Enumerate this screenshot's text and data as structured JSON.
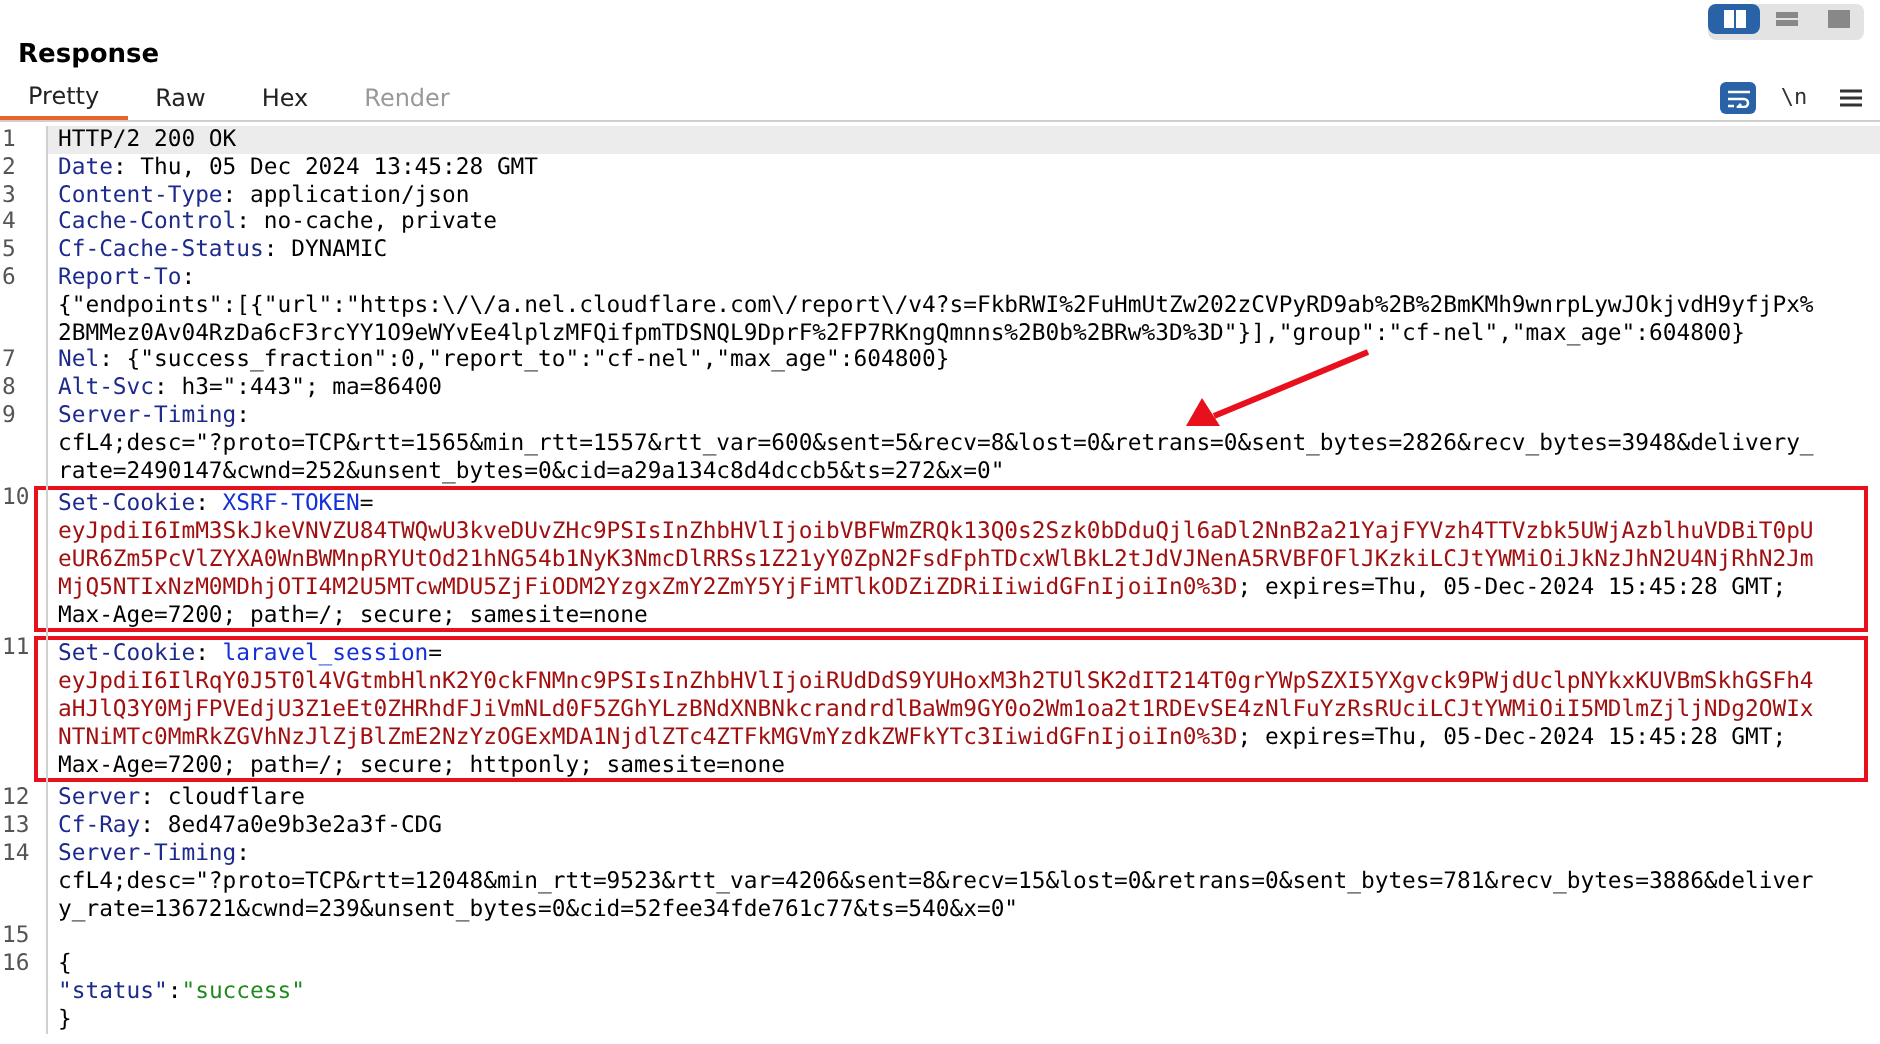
{
  "panel": {
    "title": "Response"
  },
  "view_modes": [
    {
      "kind": "columns",
      "selected": true
    },
    {
      "kind": "rows",
      "selected": false
    },
    {
      "kind": "single",
      "selected": false
    }
  ],
  "tabs": [
    {
      "label": "Pretty",
      "selected": true,
      "disabled": false
    },
    {
      "label": "Raw",
      "selected": false,
      "disabled": false
    },
    {
      "label": "Hex",
      "selected": false,
      "disabled": false
    },
    {
      "label": "Render",
      "selected": false,
      "disabled": true
    }
  ],
  "toolbar": [
    {
      "kind": "wrap",
      "selected": true
    },
    {
      "kind": "newline",
      "label": "\\n",
      "selected": false
    },
    {
      "kind": "menu",
      "selected": false
    }
  ],
  "lines": [
    {
      "number": "1",
      "current": true,
      "boxed": false,
      "wrapped": [
        {
          "spans": [
            {
              "kind": "plain",
              "text": "HTTP/2 200 OK"
            }
          ]
        }
      ]
    },
    {
      "number": "2",
      "current": false,
      "boxed": false,
      "wrapped": [
        {
          "spans": [
            {
              "kind": "name",
              "text": "Date"
            },
            {
              "kind": "plain",
              "text": ": Thu, 05 Dec 2024 13:45:28 GMT"
            }
          ]
        }
      ]
    },
    {
      "number": "3",
      "current": false,
      "boxed": false,
      "wrapped": [
        {
          "spans": [
            {
              "kind": "name",
              "text": "Content-Type"
            },
            {
              "kind": "plain",
              "text": ": application/json"
            }
          ]
        }
      ]
    },
    {
      "number": "4",
      "current": false,
      "boxed": false,
      "wrapped": [
        {
          "spans": [
            {
              "kind": "name",
              "text": "Cache-Control"
            },
            {
              "kind": "plain",
              "text": ": no-cache, private"
            }
          ]
        }
      ]
    },
    {
      "number": "5",
      "current": false,
      "boxed": false,
      "wrapped": [
        {
          "spans": [
            {
              "kind": "name",
              "text": "Cf-Cache-Status"
            },
            {
              "kind": "plain",
              "text": ": DYNAMIC"
            }
          ]
        }
      ]
    },
    {
      "number": "6",
      "current": false,
      "boxed": false,
      "wrapped": [
        {
          "spans": [
            {
              "kind": "name",
              "text": "Report-To"
            },
            {
              "kind": "plain",
              "text": ":"
            }
          ]
        },
        {
          "spans": [
            {
              "kind": "plain",
              "text": "{\"endpoints\":[{\"url\":\"https:\\/\\/a.nel.cloudflare.com\\/report\\/v4?s=FkbRWI%2FuHmUtZw202zCVPyRD9ab%2B%2BmKMh9wnrpLywJOkjvdH9yfjPx%"
            }
          ]
        },
        {
          "spans": [
            {
              "kind": "plain",
              "text": "2BMMez0Av04RzDa6cF3rcYY1O9eWYvEe4lplzMFQifpmTDSNQL9DprF%2FP7RKngQmnns%2B0b%2BRw%3D%3D\"}],\"group\":\"cf-nel\",\"max_age\":604800}"
            }
          ]
        }
      ]
    },
    {
      "number": "7",
      "current": false,
      "boxed": false,
      "wrapped": [
        {
          "spans": [
            {
              "kind": "name",
              "text": "Nel"
            },
            {
              "kind": "plain",
              "text": ": {\"success_fraction\":0,\"report_to\":\"cf-nel\",\"max_age\":604800}"
            }
          ]
        }
      ]
    },
    {
      "number": "8",
      "current": false,
      "boxed": false,
      "wrapped": [
        {
          "spans": [
            {
              "kind": "name",
              "text": "Alt-Svc"
            },
            {
              "kind": "plain",
              "text": ": h3=\":443\"; ma=86400"
            }
          ]
        }
      ]
    },
    {
      "number": "9",
      "current": false,
      "boxed": false,
      "wrapped": [
        {
          "spans": [
            {
              "kind": "name",
              "text": "Server-Timing"
            },
            {
              "kind": "plain",
              "text": ":"
            }
          ]
        },
        {
          "spans": [
            {
              "kind": "plain",
              "text": "cfL4;desc=\"?proto=TCP&rtt=1565&min_rtt=1557&rtt_var=600&sent=5&recv=8&lost=0&retrans=0&sent_bytes=2826&recv_bytes=3948&delivery_"
            }
          ]
        },
        {
          "spans": [
            {
              "kind": "plain",
              "text": "rate=2490147&cwnd=252&unsent_bytes=0&cid=a29a134c8d4dccb5&ts=272&x=0\""
            }
          ]
        }
      ]
    },
    {
      "number": "10",
      "current": false,
      "boxed": true,
      "wrapped": [
        {
          "spans": [
            {
              "kind": "name",
              "text": "Set-Cookie"
            },
            {
              "kind": "plain",
              "text": ": "
            },
            {
              "kind": "cookie-name",
              "text": "XSRF-TOKEN"
            },
            {
              "kind": "plain",
              "text": "="
            }
          ]
        },
        {
          "spans": [
            {
              "kind": "cookie-value",
              "text": "eyJpdiI6ImM3SkJkeVNVZU84TWQwU3kveDUvZHc9PSIsInZhbHVlIjoibVBFWmZRQk13Q0s2Szk0bDduQjl6aDl2NnB2a21YajFYVzh4TTVzbk5UWjAzblhuVDBiT0pU"
            }
          ]
        },
        {
          "spans": [
            {
              "kind": "cookie-value",
              "text": "eUR6Zm5PcVlZYXA0WnBWMnpRYUtOd21hNG54b1NyK3NmcDlRRSs1Z21yY0ZpN2FsdFphTDcxWlBkL2tJdVJNenA5RVBFOFlJKzkiLCJtYWMiOiJkNzJhN2U4NjRhN2Jm"
            }
          ]
        },
        {
          "spans": [
            {
              "kind": "cookie-value",
              "text": "MjQ5NTIxNzM0MDhjOTI4M2U5MTcwMDU5ZjFiODM2YzgxZmY2ZmY5YjFiMTlkODZiZDRiIiwidGFnIjoiIn0%3D"
            },
            {
              "kind": "plain",
              "text": "; expires=Thu, 05-Dec-2024 15:45:28 GMT;"
            }
          ]
        },
        {
          "spans": [
            {
              "kind": "plain",
              "text": "Max-Age=7200; path=/; secure; samesite=none"
            }
          ]
        }
      ]
    },
    {
      "number": "11",
      "current": false,
      "boxed": true,
      "wrapped": [
        {
          "spans": [
            {
              "kind": "name",
              "text": "Set-Cookie"
            },
            {
              "kind": "plain",
              "text": ": "
            },
            {
              "kind": "cookie-name",
              "text": "laravel_session"
            },
            {
              "kind": "plain",
              "text": "="
            }
          ]
        },
        {
          "spans": [
            {
              "kind": "cookie-value",
              "text": "eyJpdiI6IlRqY0J5T0l4VGtmbHlnK2Y0ckFNMnc9PSIsInZhbHVlIjoiRUdDdS9YUHoxM3h2TUlSK2dIT214T0grYWpSZXI5YXgvck9PWjdUclpNYkxKUVBmSkhGSFh4"
            }
          ]
        },
        {
          "spans": [
            {
              "kind": "cookie-value",
              "text": "aHJlQ3Y0MjFPVEdjU3Z1eEt0ZHRhdFJiVmNLd0F5ZGhYLzBNdXNBNkcrandrdlBaWm9GY0o2Wm1oa2t1RDEvSE4zNlFuYzRsRUciLCJtYWMiOiI5MDlmZjljNDg2OWIx"
            }
          ]
        },
        {
          "spans": [
            {
              "kind": "cookie-value",
              "text": "NTNiMTc0MmRkZGVhNzJlZjBlZmE2NzYzOGExMDA1NjdlZTc4ZTFkMGVmYzdkZWFkYTc3IiwidGFnIjoiIn0%3D"
            },
            {
              "kind": "plain",
              "text": "; expires=Thu, 05-Dec-2024 15:45:28 GMT;"
            }
          ]
        },
        {
          "spans": [
            {
              "kind": "plain",
              "text": "Max-Age=7200; path=/; secure; httponly; samesite=none"
            }
          ]
        }
      ]
    },
    {
      "number": "12",
      "current": false,
      "boxed": false,
      "wrapped": [
        {
          "spans": [
            {
              "kind": "name",
              "text": "Server"
            },
            {
              "kind": "plain",
              "text": ": cloudflare"
            }
          ]
        }
      ]
    },
    {
      "number": "13",
      "current": false,
      "boxed": false,
      "wrapped": [
        {
          "spans": [
            {
              "kind": "name",
              "text": "Cf-Ray"
            },
            {
              "kind": "plain",
              "text": ": 8ed47a0e9b3e2a3f-CDG"
            }
          ]
        }
      ]
    },
    {
      "number": "14",
      "current": false,
      "boxed": false,
      "wrapped": [
        {
          "spans": [
            {
              "kind": "name",
              "text": "Server-Timing"
            },
            {
              "kind": "plain",
              "text": ":"
            }
          ]
        },
        {
          "spans": [
            {
              "kind": "plain",
              "text": "cfL4;desc=\"?proto=TCP&rtt=12048&min_rtt=9523&rtt_var=4206&sent=8&recv=15&lost=0&retrans=0&sent_bytes=781&recv_bytes=3886&deliver"
            }
          ]
        },
        {
          "spans": [
            {
              "kind": "plain",
              "text": "y_rate=136721&cwnd=239&unsent_bytes=0&cid=52fee34fde761c77&ts=540&x=0\""
            }
          ]
        }
      ]
    },
    {
      "number": "15",
      "current": false,
      "boxed": false
    },
    {
      "number": "16",
      "current": false,
      "boxed": false,
      "wrapped": [
        {
          "spans": [
            {
              "kind": "plain",
              "text": "{"
            }
          ]
        },
        {
          "spans": [
            {
              "kind": "json-key",
              "text": "\"status\""
            },
            {
              "kind": "plain",
              "text": ":"
            },
            {
              "kind": "json-string",
              "text": "\"success\""
            }
          ]
        },
        {
          "spans": [
            {
              "kind": "plain",
              "text": "}"
            }
          ]
        }
      ]
    }
  ]
}
